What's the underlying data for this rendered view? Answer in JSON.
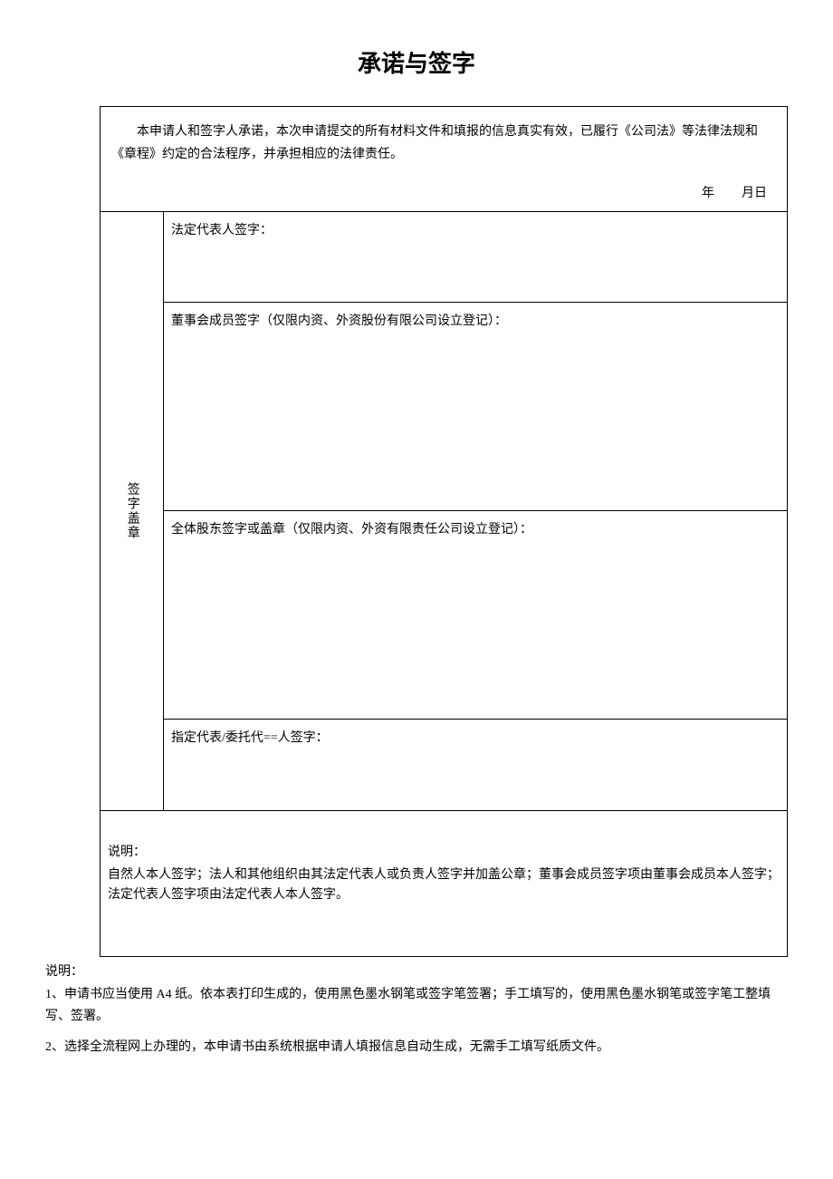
{
  "title": "承诺与签字",
  "commitment": {
    "text": "本申请人和签字人承诺，本次申请提交的所有材料文件和填报的信息真实有效，已履行《公司法》等法律法规和《章程》约定的合法程序，并承担相应的法律责任。",
    "date_year_label": "年",
    "date_month_day_label": "月日"
  },
  "sideLabel": "签字盖章",
  "signatureRows": {
    "legalRep": "法定代表人签字：",
    "board": "董事会成员签字（仅限内资、外资股份有限公司设立登记）：",
    "shareholders": "全体股东签字或盖章（仅限内资、外资有限责任公司设立登记）：",
    "agent": "指定代表/委托代==人签字："
  },
  "explanation": {
    "title": "说明：",
    "body": "自然人本人签字；法人和其他组织由其法定代表人或负责人签字并加盖公章；董事会成员签字项由董事会成员本人签字；法定代表人签字项由法定代表人本人签字。"
  },
  "footer": {
    "title": "说明：",
    "note1": "1、申请书应当使用 A4 纸。依本表打印生成的，使用黑色墨水钢笔或签字笔签署；手工填写的，使用黑色墨水钢笔或签字笔工整填写、签署。",
    "note2": "2、选择全流程网上办理的，本申请书由系统根据申请人填报信息自动生成，无需手工填写纸质文件。"
  }
}
